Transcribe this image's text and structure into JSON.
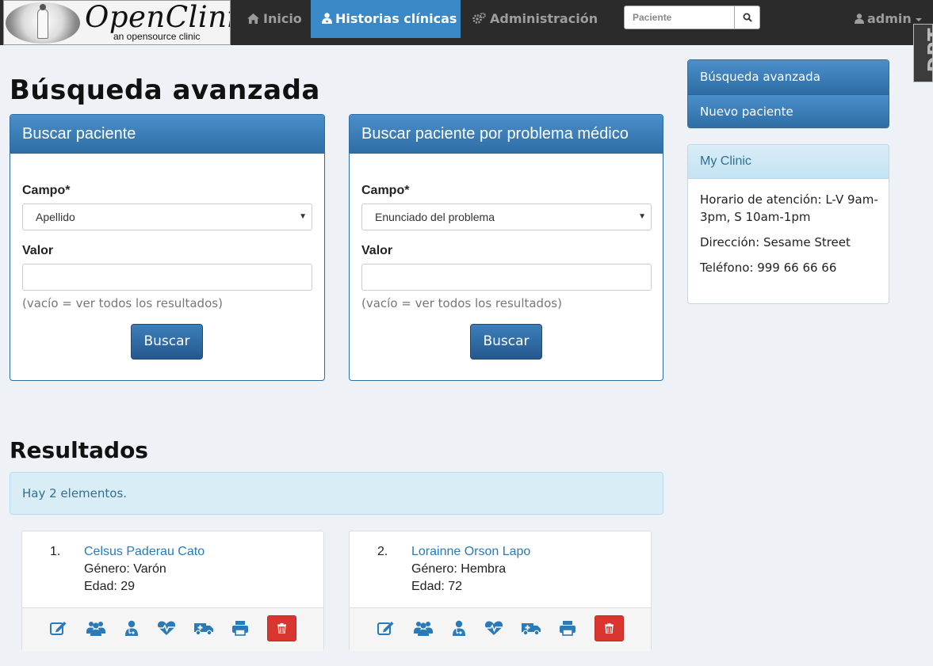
{
  "app": {
    "logo_title": "OpenClinic",
    "logo_subtitle": "an opensource clinic system"
  },
  "nav": {
    "items": [
      {
        "label": "Inicio",
        "icon": "home-icon",
        "active": false
      },
      {
        "label": "Historias clínicas",
        "icon": "user-md-icon",
        "active": true
      },
      {
        "label": "Administración",
        "icon": "cogs-icon",
        "active": false
      }
    ],
    "search_placeholder": "Paciente",
    "search_icon": "search-icon",
    "user_label": "admin",
    "debug_badge": "DPT"
  },
  "page": {
    "title": "Búsqueda avanzada"
  },
  "search_patient": {
    "heading": "Buscar paciente",
    "field_label": "Campo*",
    "field_value": "Apellido",
    "value_label": "Valor",
    "value": "",
    "help": "(vacío = ver todos los resultados)",
    "button": "Buscar"
  },
  "search_problem": {
    "heading": "Buscar paciente por problema médico",
    "field_label": "Campo*",
    "field_value": "Enunciado del problema",
    "value_label": "Valor",
    "value": "",
    "help": "(vacío = ver todos los resultados)",
    "button": "Buscar"
  },
  "sidebar": {
    "items": [
      {
        "label": "Búsqueda avanzada"
      },
      {
        "label": "Nuevo paciente"
      }
    ],
    "clinic": {
      "name": "My Clinic",
      "hours": "Horario de atención: L-V 9am-3pm, S 10am-1pm",
      "address": "Dirección: Sesame Street",
      "phone": "Teléfono: 999 66 66 66"
    }
  },
  "results": {
    "title": "Resultados",
    "count_text": "Hay 2 elementos.",
    "items": [
      {
        "number": "1.",
        "name": "Celsus Paderau Cato",
        "gender": "Género: Varón",
        "age": "Edad: 29"
      },
      {
        "number": "2.",
        "name": "Lorainne Orson Lapo",
        "gender": "Género: Hembra",
        "age": "Edad: 72"
      }
    ],
    "actions": [
      "edit-icon",
      "relatives-icon",
      "doctor-icon",
      "heartbeat-icon",
      "ambulance-icon",
      "print-icon",
      "trash-icon"
    ]
  },
  "colors": {
    "navbar": "#2b2b2b",
    "active_nav": "#3a88c6",
    "primary": "#2e6da4",
    "link": "#2a7ab8",
    "danger": "#d9362f",
    "info_bg": "#d9edf7"
  }
}
